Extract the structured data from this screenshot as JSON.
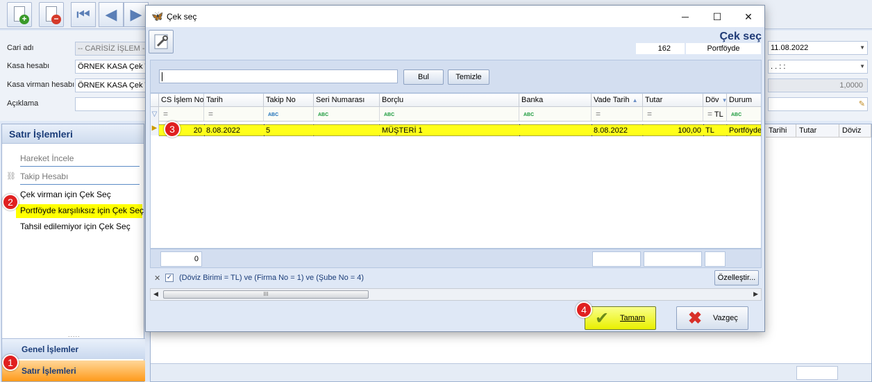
{
  "toolbar": {
    "buttons": [
      {
        "icon": "new-document-icon"
      },
      {
        "icon": "delete-document-icon"
      },
      {
        "icon": "first-record-icon"
      },
      {
        "icon": "previous-record-icon"
      },
      {
        "icon": "next-record-icon"
      }
    ]
  },
  "form": {
    "cari_label": "Cari adı",
    "cari_value": "-- CARİSİZ İŞLEM --",
    "kasa_label": "Kasa hesabı",
    "kasa_value": "ÖRNEK KASA Çek TL",
    "kasa_virman_label": "Kasa virman hesabı",
    "kasa_virman_value": "ÖRNEK KASA Çek TL",
    "aciklama_label": "Açıklama",
    "date_value": "11.08.2022",
    "time_value": ". .    : :",
    "rate_value": "1,0000"
  },
  "left_panel": {
    "title": "Satır İşlemleri",
    "items": [
      {
        "label": "Hareket İncele"
      },
      {
        "label": "Takip Hesabı"
      },
      {
        "label": "Çek virman için Çek Seç"
      },
      {
        "label": "Portföyde karşılıksız için Çek Seç"
      },
      {
        "label": "Tahsil edilemiyor için Çek Seç"
      }
    ],
    "grip": ".....",
    "tab_general": "Genel İşlemler",
    "tab_active": "Satır İşlemleri"
  },
  "right_grid": {
    "columns": [
      "Tarihi",
      "Tutar",
      "Döviz"
    ]
  },
  "callouts": [
    "1",
    "2",
    "3",
    "4"
  ],
  "dialog": {
    "title": "Çek seç",
    "big_title": "Çek seç",
    "count": "162",
    "status": "Portföyde",
    "search_button": "Bul",
    "clear_button": "Temizle",
    "columns": [
      {
        "label": "CS İşlem No"
      },
      {
        "label": "Tarih"
      },
      {
        "label": "Takip No"
      },
      {
        "label": "Seri Numarası"
      },
      {
        "label": "Borçlu"
      },
      {
        "label": "Banka"
      },
      {
        "label": "Vade Tarih"
      },
      {
        "label": "Tutar"
      },
      {
        "label": "Döv"
      },
      {
        "label": "Durum"
      }
    ],
    "filter_row": {
      "dov_value": "TL"
    },
    "rows": [
      {
        "cs_islem_no": "20",
        "tarih": "8.08.2022",
        "takip_no": "5",
        "seri_numarasi": "",
        "borclu": "MÜŞTERİ 1",
        "banka": "",
        "vade_tarih": "8.08.2022",
        "tutar": "100,00",
        "doviz": "TL",
        "durum": "Portföyde"
      }
    ],
    "footer_count": "0",
    "filter_expression": "(Döviz Birimi = TL) ve (Firma No = 1) ve (Şube No = 4)",
    "customize_button": "Özelleştir...",
    "scroll_grip": "III",
    "ok_button": "Tamam",
    "cancel_button": "Vazgeç"
  },
  "colors": {
    "accent": "#1f3a76",
    "highlight": "#ffff1a",
    "callout": "#e02020",
    "active_tab": "#ff9a1a"
  }
}
